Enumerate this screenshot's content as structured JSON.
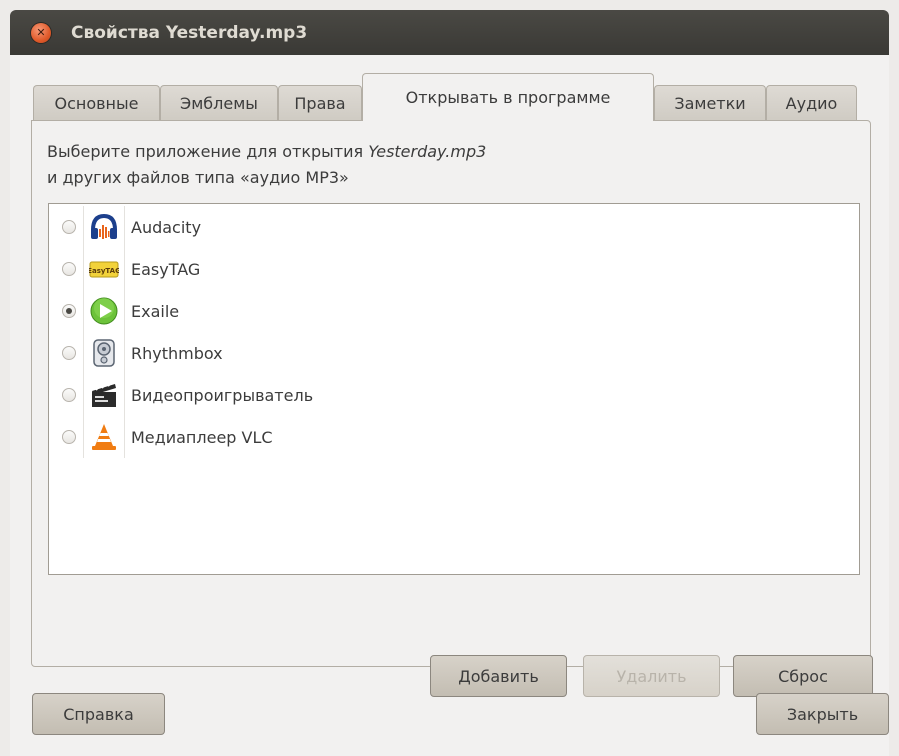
{
  "window": {
    "title": "Свойства Yesterday.mp3",
    "close_icon": "close-icon"
  },
  "tabs": [
    {
      "label": "Основные",
      "active": false
    },
    {
      "label": "Эмблемы",
      "active": false
    },
    {
      "label": "Права",
      "active": false
    },
    {
      "label": "Открывать в программе",
      "active": true
    },
    {
      "label": "Заметки",
      "active": false
    },
    {
      "label": "Аудио",
      "active": false
    }
  ],
  "panel": {
    "desc_prefix": "Выберите приложение для открытия ",
    "desc_filename": "Yesterday.mp3",
    "desc_line2": "и других файлов типа «аудио MP3»"
  },
  "apps": [
    {
      "name": "Audacity",
      "icon": "audacity-icon",
      "selected": false
    },
    {
      "name": "EasyTAG",
      "icon": "easytag-icon",
      "selected": false
    },
    {
      "name": "Exaile",
      "icon": "exaile-icon",
      "selected": true
    },
    {
      "name": "Rhythmbox",
      "icon": "rhythmbox-icon",
      "selected": false
    },
    {
      "name": "Видеопроигрыватель",
      "icon": "video-player-icon",
      "selected": false
    },
    {
      "name": "Медиаплеер VLC",
      "icon": "vlc-icon",
      "selected": false
    }
  ],
  "buttons": {
    "add": "Добавить",
    "remove": "Удалить",
    "reset": "Сброс",
    "help": "Справка",
    "close": "Закрыть"
  }
}
